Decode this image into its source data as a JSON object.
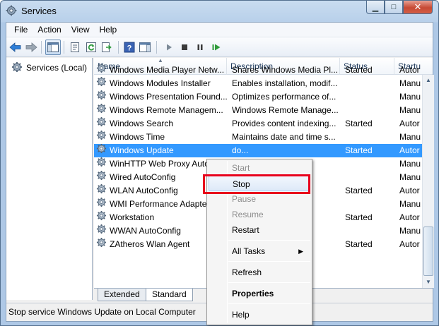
{
  "window": {
    "title": "Services",
    "minimize_icon": "minimize-icon",
    "maximize_icon": "maximize-icon",
    "close_icon": "close-icon",
    "min_glyph": "▁",
    "max_glyph": "□",
    "close_glyph": "✕"
  },
  "menu": [
    "File",
    "Action",
    "View",
    "Help"
  ],
  "toolbar": {
    "icons": [
      "back-arrow-icon",
      "forward-arrow-icon",
      "show-hide-console-tree-icon",
      "properties-icon",
      "refresh-icon",
      "export-list-icon",
      "help-icon",
      "show-hide-action-pane-icon",
      "start-service-icon",
      "stop-service-icon",
      "pause-service-icon",
      "restart-service-icon"
    ]
  },
  "tree": {
    "label": "Services (Local)",
    "icon": "gear-icon"
  },
  "columns": {
    "name": "Name",
    "description": "Description",
    "status": "Status",
    "startup": "Startu"
  },
  "services": [
    {
      "name": "Windows Media Player Netw...",
      "description": "Shares Windows Media Pl...",
      "status": "Started",
      "startup": "Autor"
    },
    {
      "name": "Windows Modules Installer",
      "description": "Enables installation, modif...",
      "status": "",
      "startup": "Manu"
    },
    {
      "name": "Windows Presentation Found...",
      "description": "Optimizes performance of...",
      "status": "",
      "startup": "Manu"
    },
    {
      "name": "Windows Remote Managem...",
      "description": "Windows Remote Manage...",
      "status": "",
      "startup": "Manu"
    },
    {
      "name": "Windows Search",
      "description": "Provides content indexing...",
      "status": "Started",
      "startup": "Autor"
    },
    {
      "name": "Windows Time",
      "description": "Maintains date and time s...",
      "status": "",
      "startup": "Manu"
    },
    {
      "name": "Windows Update",
      "description": "do...",
      "status": "Started",
      "startup": "Autor",
      "selected": true
    },
    {
      "name": "WinHTTP Web Proxy Auto",
      "description": "",
      "status": "",
      "startup": "Manu"
    },
    {
      "name": "Wired AutoConfig",
      "description": "D...",
      "status": "",
      "startup": "Manu"
    },
    {
      "name": "WLAN AutoConfig",
      "description": "",
      "status": "Started",
      "startup": "Autor"
    },
    {
      "name": "WMI Performance Adapter",
      "description": "e libr...",
      "status": "",
      "startup": "Manu"
    },
    {
      "name": "Workstation",
      "description": "s clie...",
      "status": "Started",
      "startup": "Autor"
    },
    {
      "name": "WWAN AutoConfig",
      "description": "mo...",
      "status": "",
      "startup": "Manu"
    },
    {
      "name": "ZAtheros Wlan Agent",
      "description": "n",
      "status": "Started",
      "startup": "Autor"
    }
  ],
  "tabs": [
    "Extended",
    "Standard"
  ],
  "status_bar": "Stop service Windows Update on Local Computer",
  "context_menu": {
    "items": [
      {
        "label": "Start",
        "disabled": true
      },
      {
        "label": "Stop",
        "hover": true
      },
      {
        "label": "Pause",
        "disabled": true
      },
      {
        "label": "Resume",
        "disabled": true
      },
      {
        "label": "Restart"
      },
      {
        "label": "All Tasks",
        "submenu": true
      },
      {
        "label": "Refresh"
      },
      {
        "label": "Properties",
        "bold": true
      },
      {
        "label": "Help"
      }
    ],
    "submenu_glyph": "▶"
  },
  "colors": {
    "selection": "#3399ff",
    "highlight_box": "#e8001c"
  }
}
